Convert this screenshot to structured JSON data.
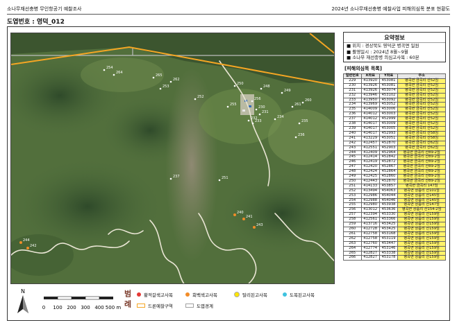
{
  "header": {
    "left_title": "소나무재선충병 무인항공기 예찰조사",
    "right_title": "2024년 소나무재선충병 예찰사업 피해의심목 분포 현황도",
    "sheet_label": "도엽번호 : 영덕_012"
  },
  "summary": {
    "title": "요약정보",
    "location": "위치 : 경상북도 영덕군 병곡면 일원",
    "date": "촬영일시 : 2024년 8월~9월",
    "count": "소나무 재선충병 의심고사목 : 60본"
  },
  "table": {
    "title": "[피해의심목 목록]",
    "headers": [
      "일련번호",
      "X좌표",
      "Y좌표",
      "주소"
    ],
    "rows": [
      [
        "229",
        "413920",
        "453081",
        "병곡면 금곡리 산52임"
      ],
      [
        "230",
        "413926",
        "453081",
        "병곡면 금곡리 산52임"
      ],
      [
        "231",
        "413926",
        "453074",
        "병곡면 금곡리 산52임"
      ],
      [
        "232",
        "413946",
        "453102",
        "병곡면 금곡리 산52임"
      ],
      [
        "233",
        "413950",
        "453092",
        "병곡면 금곡리 산52임"
      ],
      [
        "234",
        "413969",
        "453052",
        "병곡면 금곡리 산52임"
      ],
      [
        "235",
        "414009",
        "453006",
        "병곡면 금곡리 산52임"
      ],
      [
        "236",
        "414012",
        "453003",
        "병곡면 금곡리 산52임"
      ],
      [
        "237",
        "414012",
        "452999",
        "병곡면 금곡리 산52임"
      ],
      [
        "238",
        "414017",
        "453009",
        "병곡면 금곡리 산52임"
      ],
      [
        "239",
        "414017",
        "453005",
        "병곡면 금곡리 산52임"
      ],
      [
        "240",
        "414017",
        "452993",
        "병곡면 금곡리 산58임"
      ],
      [
        "241",
        "413229",
        "453051",
        "병곡면 금곡리 산58임"
      ],
      [
        "242",
        "412457",
        "452870",
        "병곡면 금곡리 산62임"
      ],
      [
        "243",
        "412551",
        "452903",
        "병곡면 금곡리 산62임"
      ],
      [
        "244",
        "412409",
        "452964",
        "병곡면 금곡리 산89-2임"
      ],
      [
        "245",
        "412414",
        "452842",
        "병곡면 금곡리 산89-2임"
      ],
      [
        "246",
        "412419",
        "452872",
        "병곡면 금곡리 산89-2임"
      ],
      [
        "247",
        "412420",
        "452867",
        "병곡면 금곡리 산89-2임"
      ],
      [
        "248",
        "412424",
        "452864",
        "병곡면 금곡리 산89-2임"
      ],
      [
        "249",
        "412425",
        "452860",
        "병곡면 금곡리 산89-2임"
      ],
      [
        "250",
        "412443",
        "452870",
        "병곡면 금곡리 산89-2임"
      ],
      [
        "251",
        "414133",
        "453857",
        "병곡면 금곡리 147임"
      ],
      [
        "252",
        "413494",
        "454063",
        "병곡면 상읍리 산101임"
      ],
      [
        "253",
        "412986",
        "454044",
        "병곡면 상읍리 산145임"
      ],
      [
        "254",
        "412988",
        "454046",
        "병곡면 상읍리 산145임"
      ],
      [
        "255",
        "412980",
        "453938",
        "병곡면 상읍리 산147임"
      ],
      [
        "256",
        "413012",
        "453636",
        "병곡면 상읍리 산154-2임"
      ],
      [
        "257",
        "412394",
        "453330",
        "병곡면 상읍리 산159임"
      ],
      [
        "258",
        "412561",
        "453366",
        "병곡면 상읍리 산159임"
      ],
      [
        "259",
        "413716",
        "453425",
        "병곡면 상읍리 산159임"
      ],
      [
        "260",
        "412728",
        "453425",
        "병곡면 상읍리 산159임"
      ],
      [
        "261",
        "412758",
        "453168",
        "병곡면 상읍리 산159임"
      ],
      [
        "262",
        "412758",
        "453119",
        "병곡면 상읍리 산159임"
      ],
      [
        "263",
        "412760",
        "453447",
        "병곡면 상읍리 산159임"
      ],
      [
        "264",
        "412774",
        "453146",
        "병곡면 상읍리 산159임"
      ],
      [
        "265",
        "412827",
        "453338",
        "병곡면 상읍리 산159임"
      ],
      [
        "266",
        "412827",
        "453178",
        "병곡면 상읍리 산159임"
      ]
    ]
  },
  "legend": {
    "title": "범례",
    "items": [
      {
        "label": "황적갈색고사목",
        "color": "#e53935",
        "kind": "dot"
      },
      {
        "label": "회백색고사목",
        "color": "#f28c28",
        "kind": "dot"
      },
      {
        "label": "탈리된고사목",
        "color": "#ffe600",
        "kind": "dot"
      },
      {
        "label": "도복된고사목",
        "color": "#3fc3e0",
        "kind": "dot"
      },
      {
        "label": "드론예찰구역",
        "color": "#f5a623",
        "kind": "box"
      },
      {
        "label": "도엽경계",
        "color": "#a0a0a0",
        "kind": "box"
      }
    ],
    "north_label": "N",
    "scale_labels": [
      "0",
      "100",
      "200",
      "300",
      "400",
      "500 m"
    ]
  },
  "map": {
    "point_labels": [
      "254",
      "264",
      "265",
      "262",
      "250",
      "248",
      "249",
      "260",
      "261",
      "253",
      "252",
      "255",
      "256",
      "230",
      "231",
      "232",
      "233",
      "234",
      "235",
      "236",
      "237",
      "251",
      "240",
      "241",
      "243",
      "244",
      "242"
    ]
  }
}
